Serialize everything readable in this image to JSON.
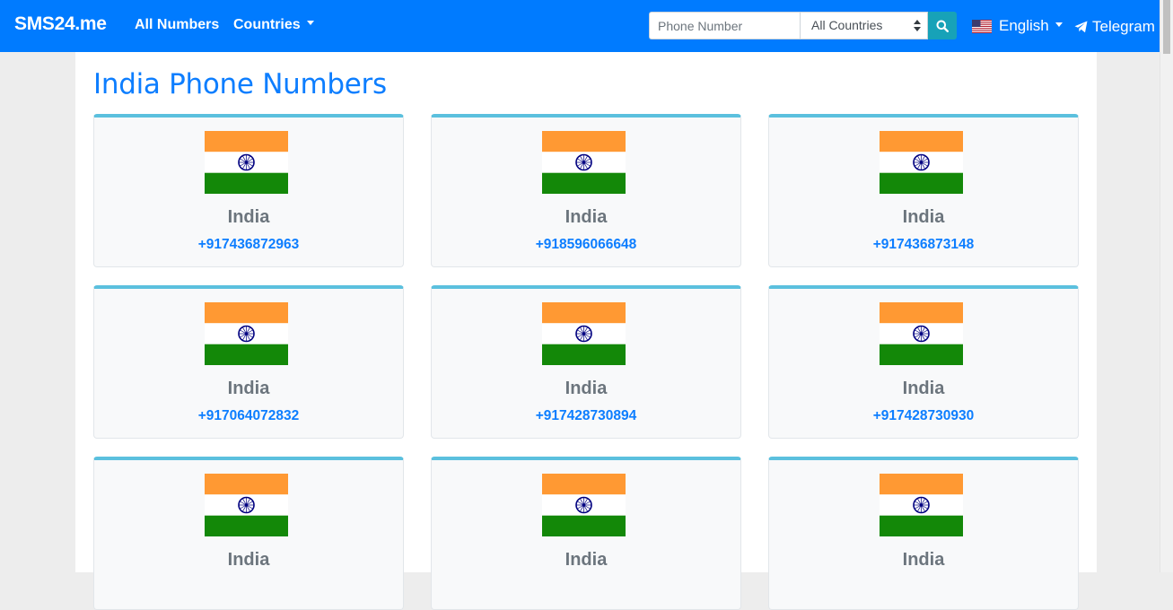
{
  "navbar": {
    "brand": "SMS24.me",
    "links": [
      "All Numbers",
      "Countries"
    ],
    "search": {
      "placeholder": "Phone Number",
      "select_value": "All Countries"
    },
    "language": "English",
    "telegram": "Telegram"
  },
  "page": {
    "title": "India Phone Numbers"
  },
  "cards": [
    {
      "country": "India",
      "number": "+917436872963"
    },
    {
      "country": "India",
      "number": "+918596066648"
    },
    {
      "country": "India",
      "number": "+917436873148"
    },
    {
      "country": "India",
      "number": "+917064072832"
    },
    {
      "country": "India",
      "number": "+917428730894"
    },
    {
      "country": "India",
      "number": "+917428730930"
    },
    {
      "country": "India",
      "number": ""
    },
    {
      "country": "India",
      "number": ""
    },
    {
      "country": "India",
      "number": ""
    }
  ],
  "colors": {
    "navbar": "#007bff",
    "accent_blue": "#0d7eff",
    "card_top_border": "#5bc0de",
    "search_button": "#17a2b8",
    "flag_saffron": "#ff9933",
    "flag_green": "#138808",
    "flag_chakra": "#000080"
  }
}
